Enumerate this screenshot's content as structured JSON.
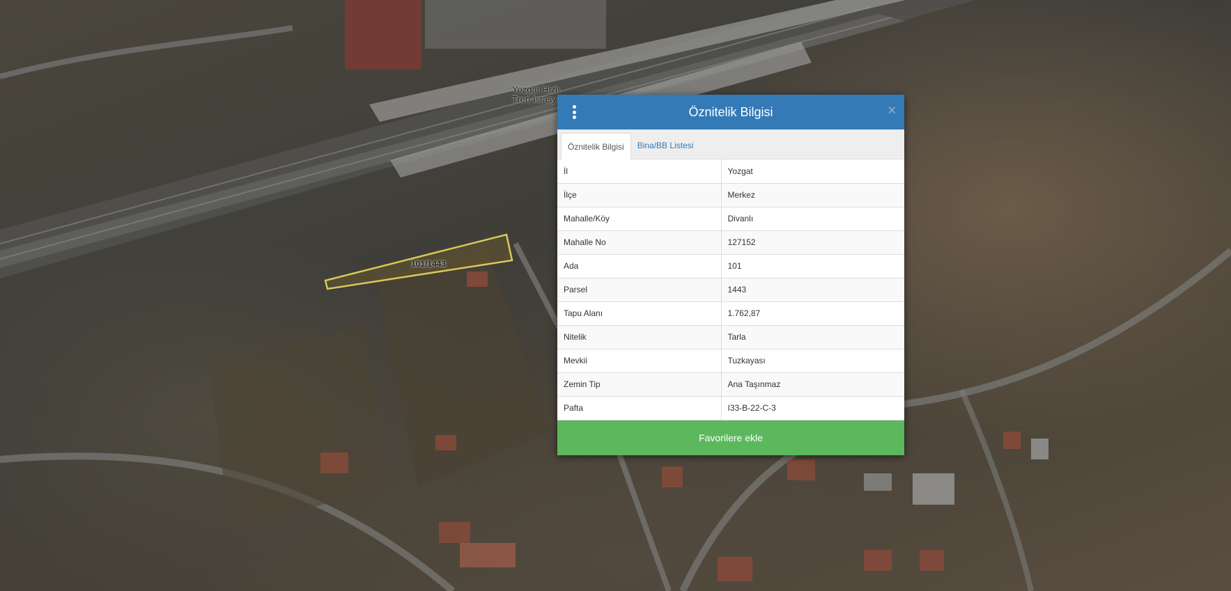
{
  "map": {
    "parcel_label": "101/1443",
    "station_label_line1": "Yozgat Hızlı",
    "station_label_line2": "Tren İstasy"
  },
  "popup": {
    "title": "Öznitelik Bilgisi",
    "close_symbol": "×",
    "tabs": [
      {
        "label": "Öznitelik Bilgisi",
        "active": true
      },
      {
        "label": "Bina/BB Listesi",
        "active": false
      }
    ],
    "rows": [
      {
        "key": "İl",
        "value": "Yozgat"
      },
      {
        "key": "İlçe",
        "value": "Merkez"
      },
      {
        "key": "Mahalle/Köy",
        "value": "Divanlı"
      },
      {
        "key": "Mahalle No",
        "value": "127152"
      },
      {
        "key": "Ada",
        "value": "101"
      },
      {
        "key": "Parsel",
        "value": "1443"
      },
      {
        "key": "Tapu Alanı",
        "value": "1.762,87"
      },
      {
        "key": "Nitelik",
        "value": "Tarla"
      },
      {
        "key": "Mevkii",
        "value": "Tuzkayası"
      },
      {
        "key": "Zemin Tip",
        "value": "Ana Taşınmaz"
      },
      {
        "key": "Pafta",
        "value": "I33-B-22-C-3"
      }
    ],
    "favorite_button_label": "Favorilere ekle"
  },
  "colors": {
    "header": "#337ab7",
    "favorite_button": "#5cb85c",
    "parcel_outline": "#d8c85a"
  },
  "icons": {
    "menu": "vertical-dots-icon",
    "close": "close-icon"
  }
}
